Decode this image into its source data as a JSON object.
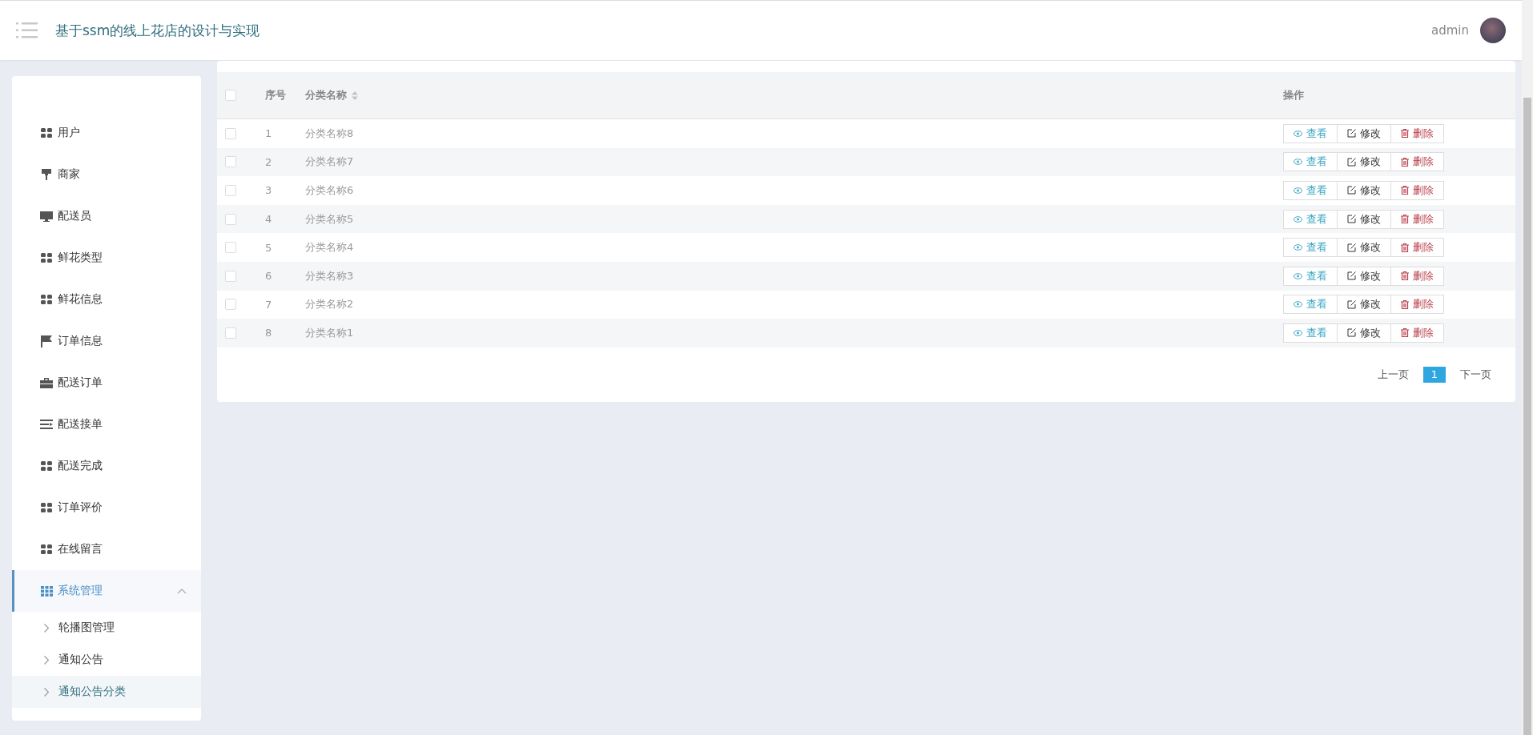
{
  "header": {
    "title": "基于ssm的线上花店的设计与实现",
    "user": "admin"
  },
  "sidebar": {
    "items": [
      {
        "label": "用户",
        "selected": false
      },
      {
        "label": "商家",
        "selected": false
      },
      {
        "label": "配送员",
        "selected": false
      },
      {
        "label": "鲜花类型",
        "selected": false
      },
      {
        "label": "鲜花信息",
        "selected": false
      },
      {
        "label": "订单信息",
        "selected": false
      },
      {
        "label": "配送订单",
        "selected": false
      },
      {
        "label": "配送接单",
        "selected": false
      },
      {
        "label": "配送完成",
        "selected": false
      },
      {
        "label": "订单评价",
        "selected": false
      },
      {
        "label": "在线留言",
        "selected": false
      },
      {
        "label": "系统管理",
        "selected": true,
        "expanded": true,
        "children": [
          {
            "label": "轮播图管理",
            "selected": false
          },
          {
            "label": "通知公告",
            "selected": false
          },
          {
            "label": "通知公告分类",
            "selected": true
          }
        ]
      }
    ]
  },
  "table": {
    "columns": [
      {
        "label": "序号",
        "sortable": false
      },
      {
        "label": "分类名称",
        "sortable": true
      },
      {
        "label": "操作",
        "sortable": false
      }
    ],
    "rows": [
      {
        "checked": false,
        "index": "1",
        "name": "分类名称8",
        "actions": [
          {
            "kind": "view",
            "label": "查看"
          },
          {
            "kind": "edit",
            "label": "修改"
          },
          {
            "kind": "delete",
            "label": "删除"
          }
        ]
      },
      {
        "checked": false,
        "index": "2",
        "name": "分类名称7",
        "actions": [
          {
            "kind": "view",
            "label": "查看"
          },
          {
            "kind": "edit",
            "label": "修改"
          },
          {
            "kind": "delete",
            "label": "删除"
          }
        ]
      },
      {
        "checked": false,
        "index": "3",
        "name": "分类名称6",
        "actions": [
          {
            "kind": "view",
            "label": "查看"
          },
          {
            "kind": "edit",
            "label": "修改"
          },
          {
            "kind": "delete",
            "label": "删除"
          }
        ]
      },
      {
        "checked": false,
        "index": "4",
        "name": "分类名称5",
        "actions": [
          {
            "kind": "view",
            "label": "查看"
          },
          {
            "kind": "edit",
            "label": "修改"
          },
          {
            "kind": "delete",
            "label": "删除"
          }
        ]
      },
      {
        "checked": false,
        "index": "5",
        "name": "分类名称4",
        "actions": [
          {
            "kind": "view",
            "label": "查看"
          },
          {
            "kind": "edit",
            "label": "修改"
          },
          {
            "kind": "delete",
            "label": "删除"
          }
        ]
      },
      {
        "checked": false,
        "index": "6",
        "name": "分类名称3",
        "actions": [
          {
            "kind": "view",
            "label": "查看"
          },
          {
            "kind": "edit",
            "label": "修改"
          },
          {
            "kind": "delete",
            "label": "删除"
          }
        ]
      },
      {
        "checked": false,
        "index": "7",
        "name": "分类名称2",
        "actions": [
          {
            "kind": "view",
            "label": "查看"
          },
          {
            "kind": "edit",
            "label": "修改"
          },
          {
            "kind": "delete",
            "label": "删除"
          }
        ]
      },
      {
        "checked": false,
        "index": "8",
        "name": "分类名称1",
        "actions": [
          {
            "kind": "view",
            "label": "查看"
          },
          {
            "kind": "edit",
            "label": "修改"
          },
          {
            "kind": "delete",
            "label": "删除"
          }
        ]
      }
    ],
    "select_all": {
      "checked": false
    }
  },
  "pagination": {
    "prev": "上一页",
    "pages": [
      {
        "label": "1",
        "selected": true
      }
    ],
    "next": "下一页"
  }
}
